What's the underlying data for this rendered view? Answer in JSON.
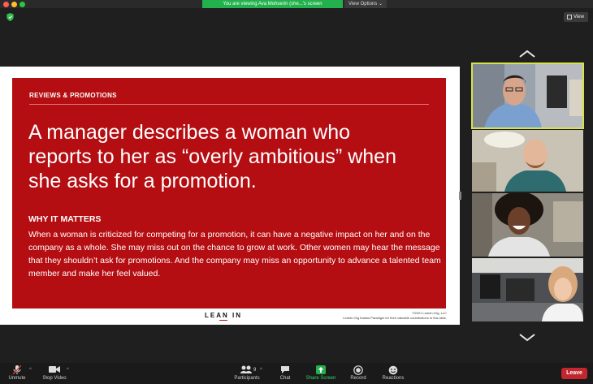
{
  "window": {
    "share_banner": "You are viewing Ava Mohserin (she...'s screen",
    "view_options_label": "View Options ⌄",
    "view_label": "View"
  },
  "slide": {
    "kicker": "REVIEWS & PROMOTIONS",
    "headline": "A manager describes a woman who reports to her as “overly ambitious” when she asks for a promotion.",
    "why_title": "WHY IT MATTERS",
    "why_body": "When a woman is criticized for competing for a promotion, it can have a negative impact on her and on the company as a whole. She may miss out on the chance to grow at work. Other women may hear the message that they shouldn’t ask for promotions. And the company may miss an opportunity to advance a talented team member and make her feel valued.",
    "logo": "LEAN IN",
    "credit_line1": "©2021 LeanIn.Org, LLC",
    "credit_line2": "LeanIn.Org thanks Paradigm for their valuable contributions to this slide.",
    "brand_color": "#b50e12"
  },
  "toolbar": {
    "unmute": "Unmute",
    "stop_video": "Stop Video",
    "participants": "Participants",
    "participants_count": "9",
    "chat": "Chat",
    "share_screen": "Share Screen",
    "record": "Record",
    "reactions": "Reactions",
    "leave": "Leave",
    "caret": "^",
    "share_color": "#22b14c",
    "leave_color": "#c1272d"
  },
  "icons": {
    "security": "shield-icon",
    "view": "grid-icon",
    "scroll_up": "chevron-up-icon",
    "scroll_down": "chevron-down-icon",
    "microphone": "microphone-muted-icon",
    "video": "video-camera-icon",
    "participants": "people-icon",
    "chat": "chat-bubble-icon",
    "share": "share-arrow-icon",
    "record": "record-icon",
    "reactions": "smiley-icon"
  }
}
